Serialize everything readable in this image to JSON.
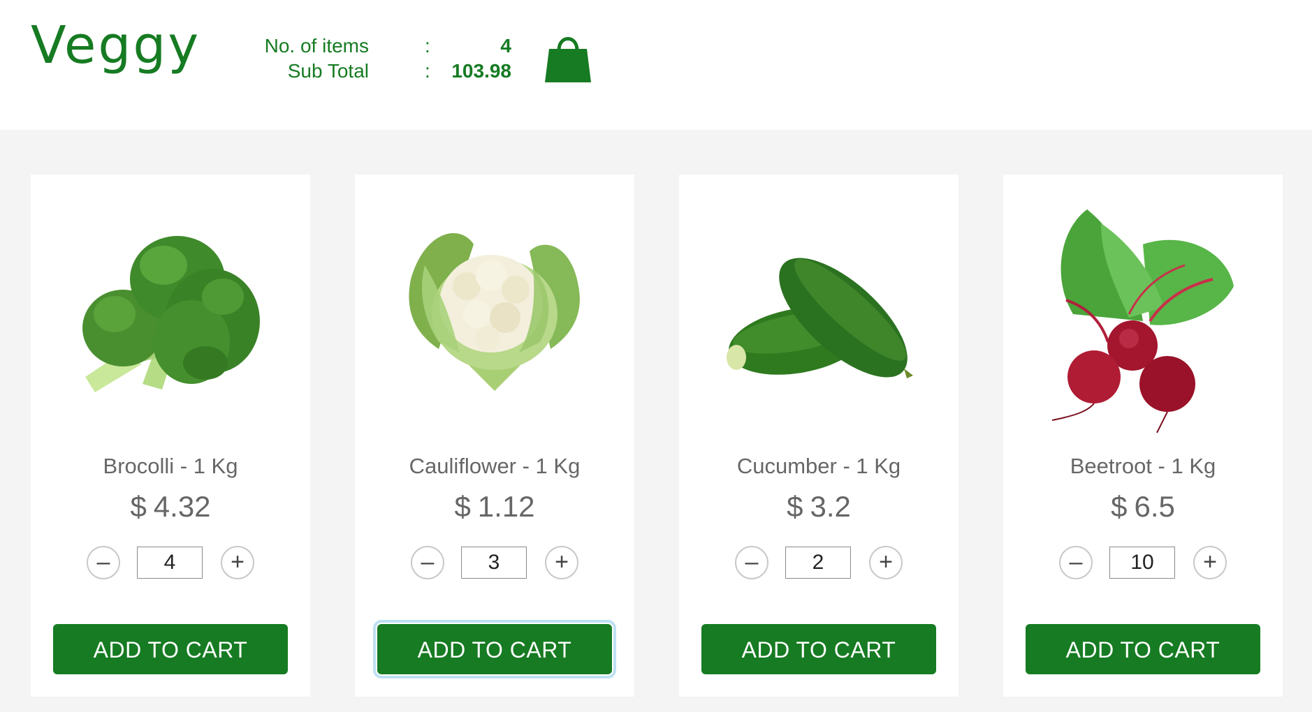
{
  "app": {
    "brand": "Veggy"
  },
  "cart": {
    "items_label": "No. of items",
    "items_value": "4",
    "subtotal_label": "Sub Total",
    "subtotal_value": "103.98",
    "separator": ":",
    "icon": "shopping-bag-icon"
  },
  "colors": {
    "brand_green": "#167b22",
    "page_bg": "#f4f4f4",
    "text_gray": "#666666"
  },
  "products": [
    {
      "name": "Brocolli - 1 Kg",
      "currency": "$",
      "price": "4.32",
      "quantity": "4",
      "button_label": "ADD TO CART",
      "minus_label": "–",
      "plus_label": "+",
      "image": "broccoli"
    },
    {
      "name": "Cauliflower - 1 Kg",
      "currency": "$",
      "price": "1.12",
      "quantity": "3",
      "button_label": "ADD TO CART",
      "minus_label": "–",
      "plus_label": "+",
      "image": "cauliflower"
    },
    {
      "name": "Cucumber - 1 Kg",
      "currency": "$",
      "price": "3.2",
      "quantity": "2",
      "button_label": "ADD TO CART",
      "minus_label": "–",
      "plus_label": "+",
      "image": "cucumber"
    },
    {
      "name": "Beetroot - 1 Kg",
      "currency": "$",
      "price": "6.5",
      "quantity": "10",
      "button_label": "ADD TO CART",
      "minus_label": "–",
      "plus_label": "+",
      "image": "beetroot"
    }
  ]
}
